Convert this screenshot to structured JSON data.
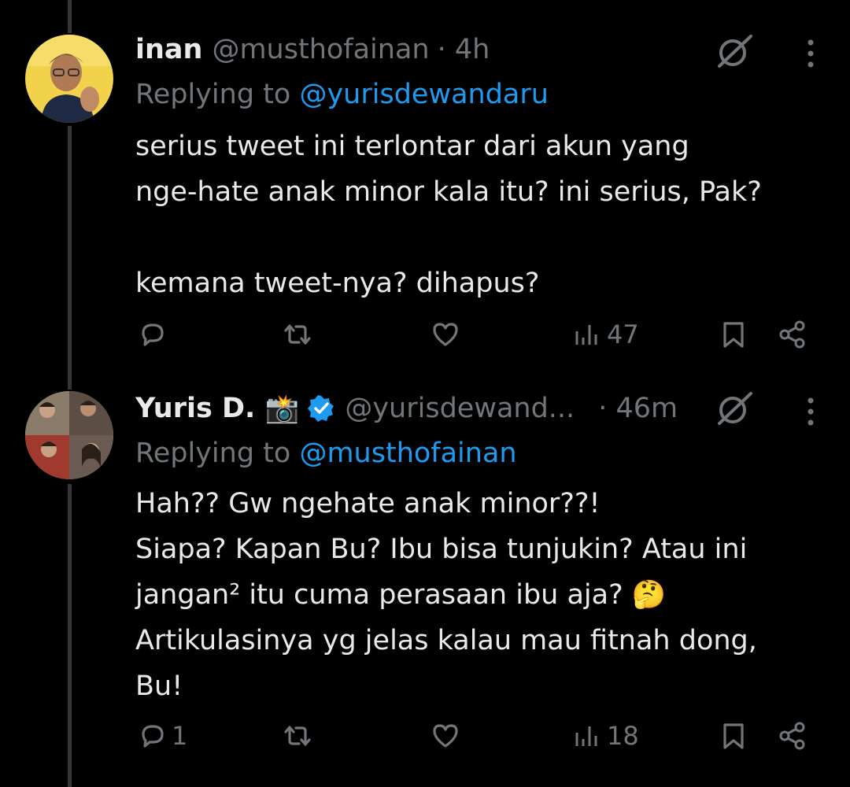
{
  "tweets": [
    {
      "display_name": "inan",
      "handle": "@musthofainan",
      "time": "· 4h",
      "replying_prefix": "Replying to ",
      "replying_to": "@yurisdewandaru",
      "lines": [
        "serius tweet ini terlontar dari akun yang",
        "nge-hate anak minor kala itu? ini serius, Pak?",
        "",
        "kemana tweet-nya? dihapus?"
      ],
      "reply_count": "",
      "views": "47"
    },
    {
      "display_name": "Yuris D.",
      "name_emoji": "📸",
      "verified": true,
      "handle": "@yurisdewand...",
      "time": "· 46m",
      "replying_prefix": "Replying to ",
      "replying_to": "@musthofainan",
      "lines": [
        "Hah?? Gw ngehate anak minor??!",
        "Siapa? Kapan Bu? Ibu bisa tunjukin? Atau ini",
        "jangan² itu cuma perasaan ibu aja? 🤔",
        "Artikulasinya yg jelas kalau mau fitnah dong,",
        "Bu!"
      ],
      "reply_count": "1",
      "views": "18"
    }
  ],
  "icons": {
    "reply": "reply-icon",
    "retweet": "retweet-icon",
    "like": "heart-icon",
    "views": "views-icon",
    "bookmark": "bookmark-icon",
    "share": "share-icon",
    "grok": "grok-icon",
    "more": "more-icon",
    "verified": "verified-badge-icon"
  },
  "colors": {
    "background": "#000000",
    "text": "#e7e9ea",
    "secondary": "#71767b",
    "accent": "#1d9bf0"
  }
}
